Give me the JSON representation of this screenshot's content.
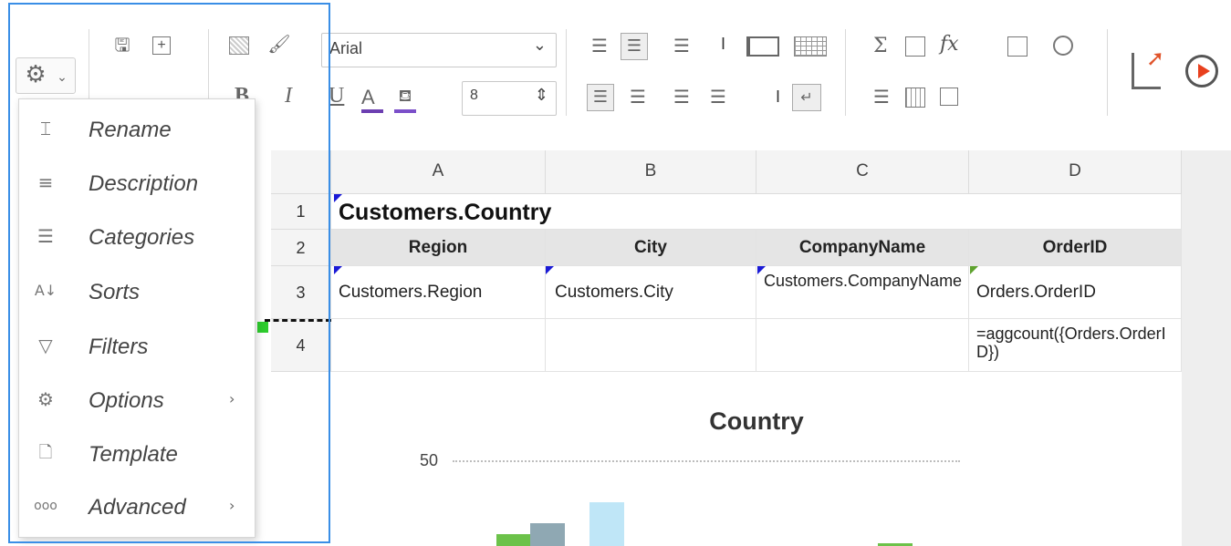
{
  "toolbar": {
    "font_name": "Arial",
    "font_size": "8",
    "bold_glyph": "B",
    "italic_glyph": "I",
    "underline_glyph": "U",
    "color_glyph": "A",
    "dropdown_glyph": "⌄",
    "spinner_glyph": "⇕",
    "separator_glyph": "I",
    "sum_glyph": "Σ",
    "function_glyph": "fx"
  },
  "menu": {
    "items": [
      {
        "label": "Rename",
        "icon": "rename-icon",
        "submenu": false
      },
      {
        "label": "Description",
        "icon": "description-icon",
        "submenu": false
      },
      {
        "label": "Categories",
        "icon": "categories-icon",
        "submenu": false
      },
      {
        "label": "Sorts",
        "icon": "sort-az-icon",
        "submenu": false
      },
      {
        "label": "Filters",
        "icon": "filter-icon",
        "submenu": false
      },
      {
        "label": "Options",
        "icon": "options-gear-icon",
        "submenu": true
      },
      {
        "label": "Template",
        "icon": "template-icon",
        "submenu": false
      },
      {
        "label": "Advanced",
        "icon": "more-dots-icon",
        "submenu": true
      }
    ],
    "submenu_arrow": "›"
  },
  "grid": {
    "columns": [
      "A",
      "B",
      "C",
      "D"
    ],
    "rows": [
      "1",
      "2",
      "3",
      "4"
    ],
    "row1": {
      "A": "Customers.Country"
    },
    "row2": {
      "A": "Region",
      "B": "City",
      "C": "CompanyName",
      "D": "OrderID"
    },
    "row3": {
      "A": "Customers.Region",
      "B": "Customers.City",
      "C": "Customers.CompanyName",
      "D": "Orders.OrderID"
    },
    "row4": {
      "D": "=aggcount({Orders.OrderID})"
    }
  },
  "chart_data": {
    "type": "bar",
    "title": "Country",
    "ytick_top": "50",
    "colors": [
      "#6cc24a",
      "#8fa8b3",
      "#bfe6f7"
    ]
  }
}
